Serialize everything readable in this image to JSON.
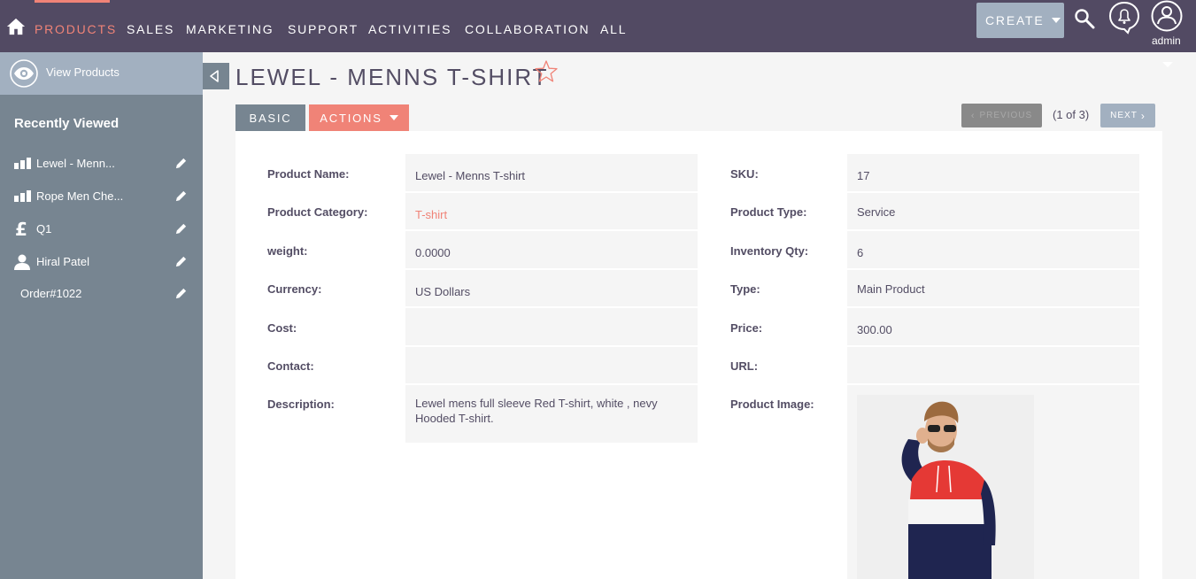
{
  "nav": {
    "items": [
      "PRODUCTS",
      "SALES",
      "MARKETING",
      "SUPPORT",
      "ACTIVITIES",
      "COLLABORATION",
      "ALL"
    ],
    "create_label": "CREATE",
    "user_label": "admin"
  },
  "sidebar": {
    "view_products": "View Products",
    "recent_title": "Recently Viewed",
    "recent_items": [
      {
        "label": "Lewel - Menn...",
        "icon": "chart-bars-icon"
      },
      {
        "label": "Rope Men Che...",
        "icon": "chart-bars-icon"
      },
      {
        "label": "Q1",
        "icon": "pound-icon"
      },
      {
        "label": "Hiral Patel",
        "icon": "person-icon"
      },
      {
        "label": "Order#1022",
        "icon": ""
      }
    ]
  },
  "header": {
    "title": "LEWEL - MENNS T-SHIRT"
  },
  "tabs": {
    "basic": "BASIC",
    "actions": "ACTIONS"
  },
  "pager": {
    "previous": "PREVIOUS",
    "count": "(1 of 3)",
    "next": "NEXT"
  },
  "fields": {
    "product_name": {
      "label": "Product Name:",
      "value": "Lewel - Menns T-shirt"
    },
    "product_category": {
      "label": "Product Category:",
      "value": "T-shirt"
    },
    "weight": {
      "label": "weight:",
      "value": "0.0000"
    },
    "currency": {
      "label": "Currency:",
      "value": "US Dollars"
    },
    "cost": {
      "label": "Cost:",
      "value": ""
    },
    "contact": {
      "label": "Contact:",
      "value": ""
    },
    "description": {
      "label": "Description:",
      "value": "Lewel mens full sleeve Red T-shirt, white , nevy Hooded T-shirt."
    },
    "sku": {
      "label": "SKU:",
      "value": "17"
    },
    "product_type": {
      "label": "Product Type:",
      "value": "Service"
    },
    "inventory_qty": {
      "label": "Inventory Qty:",
      "value": "6"
    },
    "type": {
      "label": "Type:",
      "value": "Main Product"
    },
    "price": {
      "label": "Price:",
      "value": "300.00"
    },
    "url": {
      "label": "URL:",
      "value": ""
    },
    "product_image": {
      "label": "Product Image:"
    }
  },
  "colors": {
    "nav_bg": "#524a63",
    "accent": "#f08377",
    "sidebar_bg": "#778591",
    "sidebar_highlight": "#a2b0c0"
  }
}
